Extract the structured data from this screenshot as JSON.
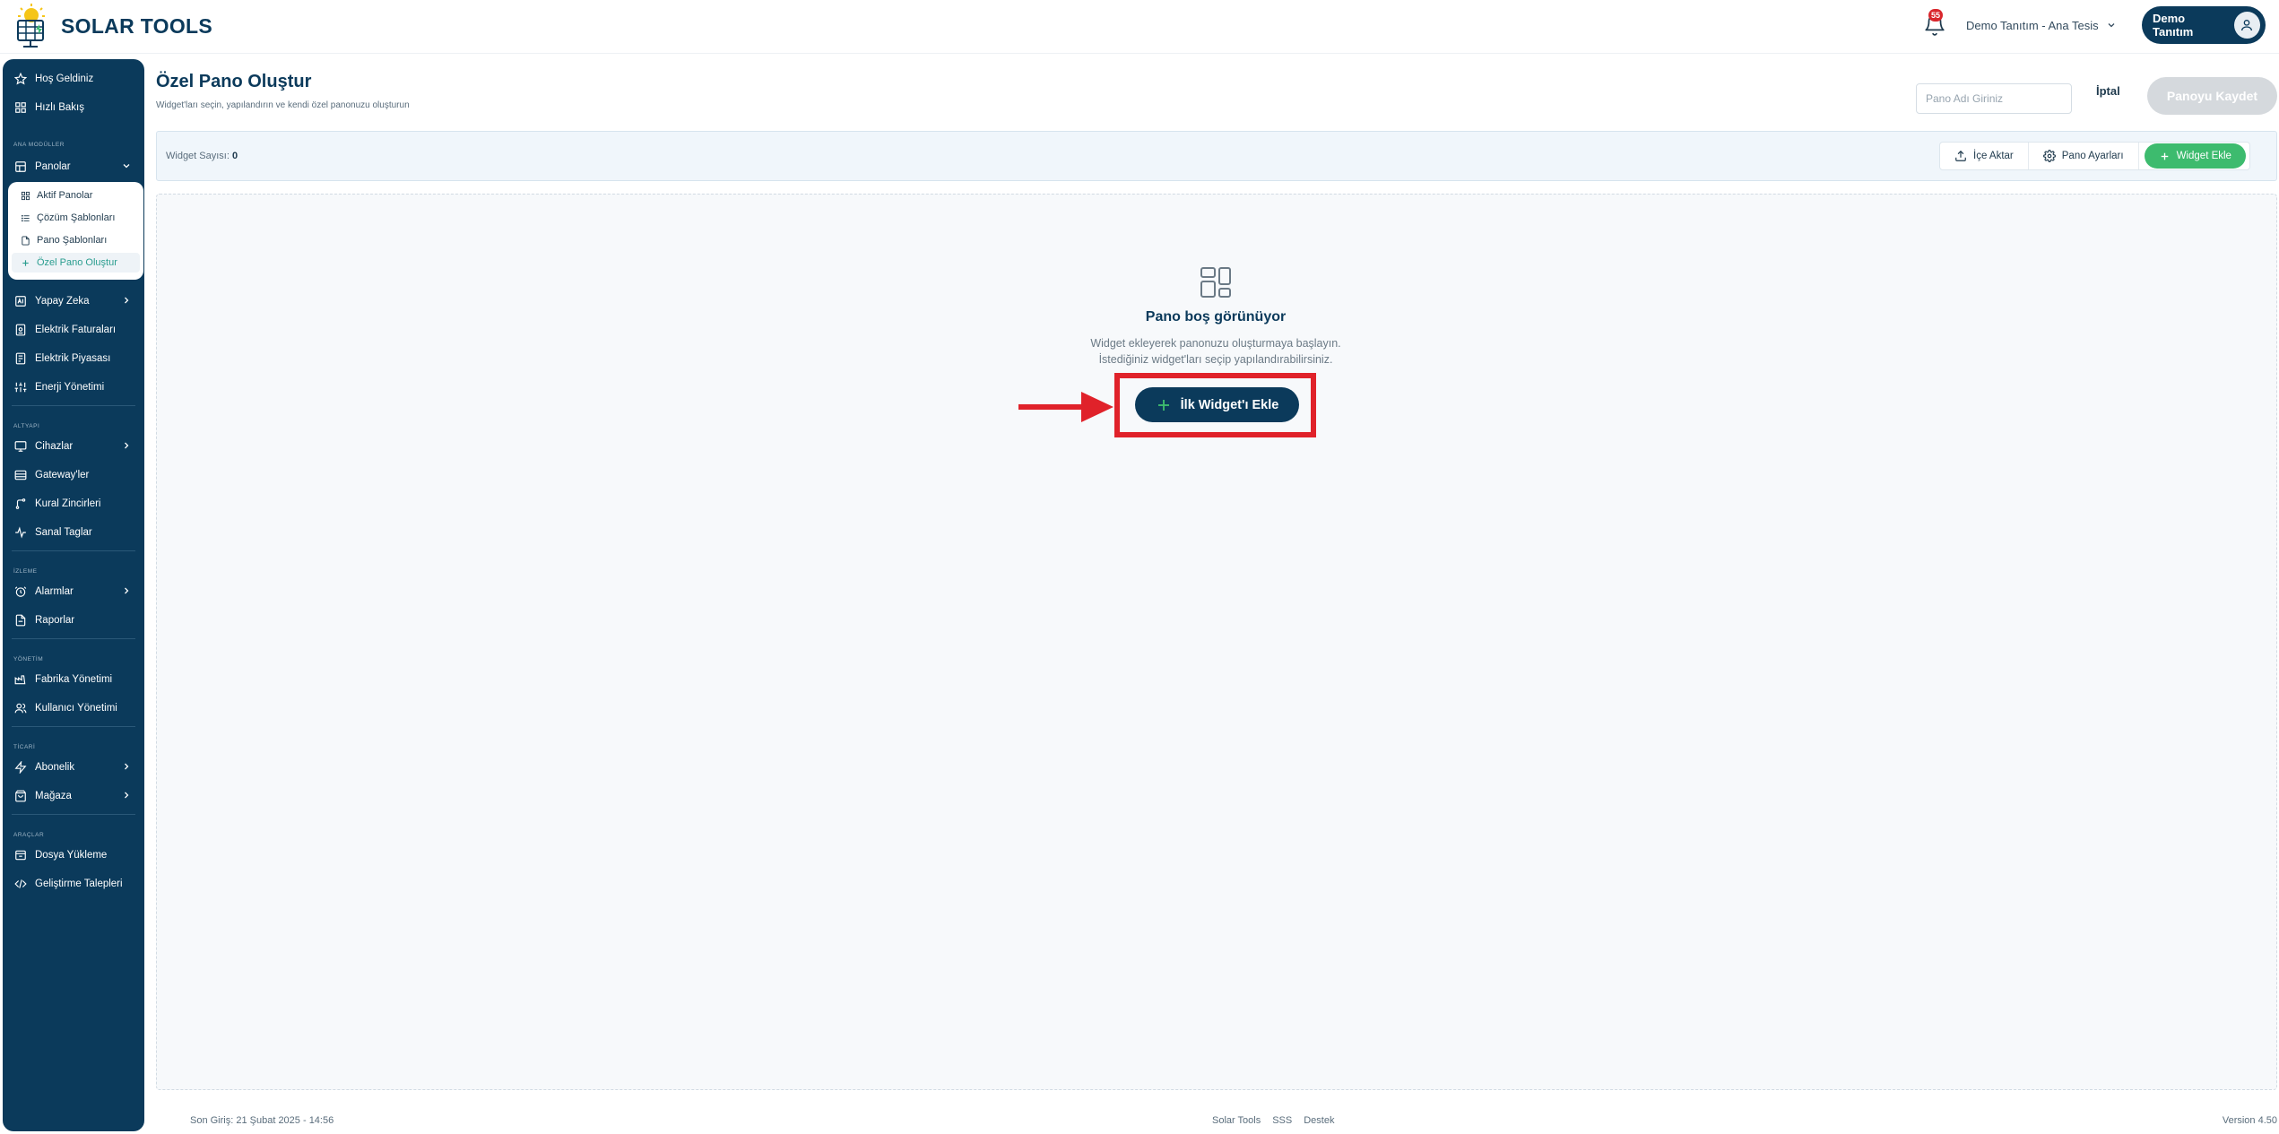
{
  "app": {
    "logo_text": "SOLAR TOOLS"
  },
  "header": {
    "notification_count": "55",
    "tenant": "Demo Tanıtım - Ana Tesis",
    "user_name": "Demo Tanıtım"
  },
  "sidebar": {
    "top_items": [
      {
        "label": "Hoş Geldiniz",
        "icon": "star-icon"
      },
      {
        "label": "Hızlı Bakış",
        "icon": "grid-icon"
      }
    ],
    "sections": {
      "main_modules": "ANA MODÜLLER",
      "infrastructure": "ALTYAPI",
      "monitoring": "İZLEME",
      "management": "YÖNETİM",
      "commerce": "TİCARİ",
      "tools": "ARAÇLAR"
    },
    "panolar": "Panolar",
    "submenu": [
      {
        "label": "Aktif Panolar",
        "icon": "grid-icon"
      },
      {
        "label": "Çözüm Şablonları",
        "icon": "list-icon"
      },
      {
        "label": "Pano Şablonları",
        "icon": "file-icon"
      },
      {
        "label": "Özel Pano Oluştur",
        "icon": "plus-icon",
        "active": true
      }
    ],
    "items_main": [
      {
        "label": "Yapay Zeka",
        "icon": "ai-icon",
        "has_children": true
      },
      {
        "label": "Elektrik Faturaları",
        "icon": "invoice-icon"
      },
      {
        "label": "Elektrik Piyasası",
        "icon": "market-icon"
      },
      {
        "label": "Enerji Yönetimi",
        "icon": "sliders-icon"
      }
    ],
    "items_infra": [
      {
        "label": "Cihazlar",
        "icon": "monitor-icon",
        "has_children": true
      },
      {
        "label": "Gateway'ler",
        "icon": "gateway-icon"
      },
      {
        "label": "Kural Zincirleri",
        "icon": "branch-icon"
      },
      {
        "label": "Sanal Taglar",
        "icon": "pulse-icon"
      }
    ],
    "items_monitoring": [
      {
        "label": "Alarmlar",
        "icon": "alarm-icon",
        "has_children": true
      },
      {
        "label": "Raporlar",
        "icon": "report-icon"
      }
    ],
    "items_management": [
      {
        "label": "Fabrika Yönetimi",
        "icon": "factory-icon"
      },
      {
        "label": "Kullanıcı Yönetimi",
        "icon": "users-icon"
      }
    ],
    "items_commerce": [
      {
        "label": "Abonelik",
        "icon": "bolt-icon",
        "has_children": true
      },
      {
        "label": "Mağaza",
        "icon": "shop-icon",
        "has_children": true
      }
    ],
    "items_tools": [
      {
        "label": "Dosya Yükleme",
        "icon": "upload-box-icon"
      },
      {
        "label": "Geliştirme Talepleri",
        "icon": "code-icon"
      }
    ]
  },
  "main": {
    "title": "Özel Pano Oluştur",
    "subtitle": "Widget'ları seçin, yapılandırın ve kendi özel panonuzu oluşturun",
    "name_placeholder": "Pano Adı Giriniz",
    "cancel_label": "İptal",
    "save_label": "Panoyu Kaydet",
    "widget_count_label": "Widget Sayısı:",
    "widget_count": "0",
    "import_label": "İçe Aktar",
    "settings_label": "Pano Ayarları",
    "add_widget_label": "Widget Ekle",
    "empty_title": "Pano boş görünüyor",
    "empty_desc_1": "Widget ekleyerek panonuzu oluşturmaya başlayın.",
    "empty_desc_2": "İstediğiniz widget'ları seçip yapılandırabilirsiniz.",
    "first_widget_label": "İlk Widget'ı Ekle"
  },
  "footer": {
    "last_login": "Son Giriş: 21 Şubat 2025 - 14:56",
    "links": [
      "Solar Tools",
      "SSS",
      "Destek"
    ],
    "version": "Version 4.50"
  },
  "colors": {
    "brand": "#0b3a5b",
    "accent_green": "#3dbb6e",
    "highlight": "#e0222a"
  }
}
